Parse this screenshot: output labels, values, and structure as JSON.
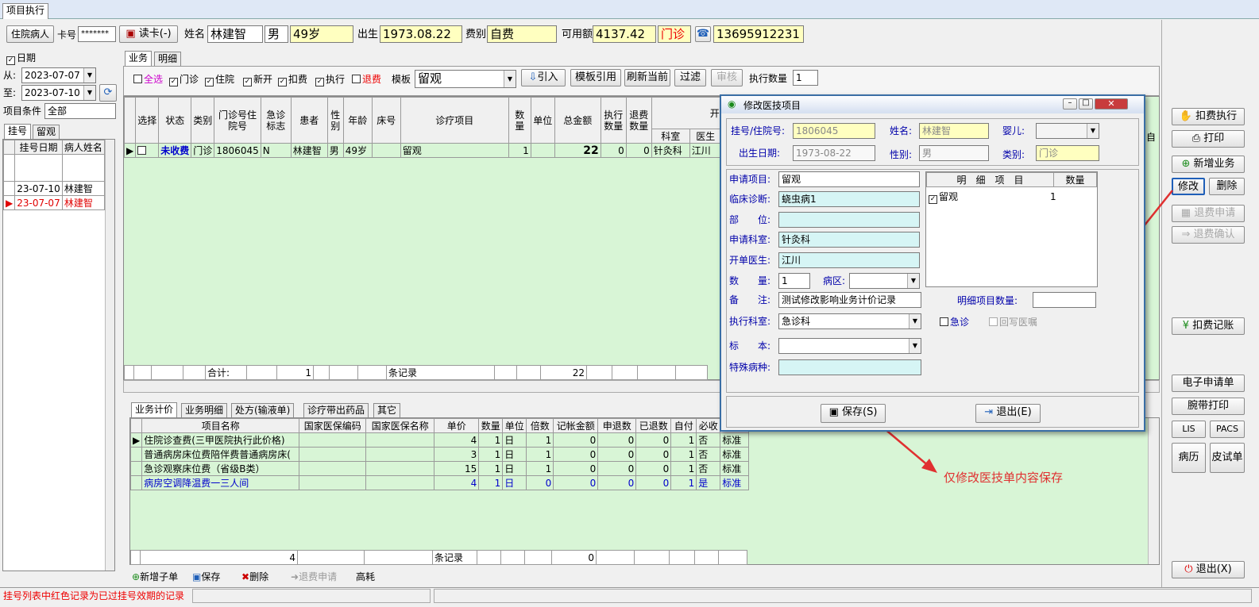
{
  "window": {
    "tab": "项目执行"
  },
  "topbar": {
    "inpatient_btn": "住院病人",
    "card_label": "卡号",
    "card_value": "*******",
    "read_card_btn": "读卡(-)",
    "name_label": "姓名",
    "name": "林建智",
    "gender": "男",
    "age": "49岁",
    "dob_label": "出生",
    "dob": "1973.08.22",
    "fee_label": "费别",
    "fee_type": "自费",
    "balance_label": "可用额",
    "balance": "4137.42",
    "visit_type": "门诊",
    "phone": "13695912231"
  },
  "left": {
    "date_label": "日期",
    "from_label": "从:",
    "from_date": "2023-07-07",
    "to_label": "至:",
    "to_date": "2023-07-10",
    "cond_label": "项目条件",
    "cond_value": "全部",
    "tabs": [
      "挂号",
      "留观"
    ],
    "cols": [
      "挂号日期",
      "病人姓名"
    ],
    "rows": [
      {
        "date": "23-07-10",
        "name": "林建智"
      },
      {
        "date": "23-07-07",
        "name": "林建智"
      }
    ]
  },
  "main_tabs": [
    "业务",
    "明细"
  ],
  "filter": {
    "all": "全选",
    "outpatient": "门诊",
    "inpatient": "住院",
    "new": "新开",
    "deduct": "扣费",
    "execute": "执行",
    "refund": "退费",
    "template_label": "模板",
    "template_value": "留观",
    "import_btn": "引入",
    "tpl_ref_btn": "模板引用",
    "refresh_btn": "刷新当前",
    "filter_btn": "过滤",
    "audit_btn": "审核",
    "exec_qty_label": "执行数量",
    "exec_qty": "1"
  },
  "grid": {
    "cols": [
      "选择",
      "状态",
      "类别",
      "门诊号住院号",
      "急诊标志",
      "患者",
      "性别",
      "年龄",
      "床号",
      "诊疗项目",
      "数量",
      "单位",
      "总金额",
      "执行数量",
      "退费数量",
      "科室",
      "医生"
    ],
    "group_header": "开",
    "row": {
      "status": "未收费",
      "type": "门诊",
      "no": "1806045",
      "urgent": "N",
      "patient": "林建智",
      "gender": "男",
      "age": "49岁",
      "bed": "",
      "item": "留观",
      "qty": "1",
      "unit": "",
      "total": "22",
      "exec": "0",
      "refund": "0",
      "dept": "针灸科",
      "doctor": "江川"
    },
    "footer": {
      "sum_label": "合计:",
      "qty": "1",
      "rec_label": "条记录",
      "total": "22"
    },
    "right_edge": "自"
  },
  "lower_tabs": [
    "业务计价",
    "业务明细",
    "处方(输液单)",
    "诊疗带出药品",
    "其它"
  ],
  "price": {
    "cols": [
      "项目名称",
      "国家医保编码",
      "国家医保名称",
      "单价",
      "数量",
      "单位",
      "倍数",
      "记帐金额",
      "申退数",
      "已退数",
      "自付",
      "必收",
      ""
    ],
    "rows": [
      {
        "name": "住院诊查费(三甲医院执行此价格)",
        "code": "",
        "cname": "",
        "price": "4",
        "qty": "1",
        "unit": "日",
        "mult": "1",
        "amt": "0",
        "req": "0",
        "ret": "0",
        "self": "1",
        "must": "否",
        "std": "标准"
      },
      {
        "name": "普通病房床位费陪伴费普通病房床(",
        "code": "",
        "cname": "",
        "price": "3",
        "qty": "1",
        "unit": "日",
        "mult": "1",
        "amt": "0",
        "req": "0",
        "ret": "0",
        "self": "1",
        "must": "否",
        "std": "标准"
      },
      {
        "name": "急诊观察床位费（省级B类）",
        "code": "",
        "cname": "",
        "price": "15",
        "qty": "1",
        "unit": "日",
        "mult": "1",
        "amt": "0",
        "req": "0",
        "ret": "0",
        "self": "1",
        "must": "否",
        "std": "标准"
      },
      {
        "name": "病房空调降温费一三人间",
        "code": "",
        "cname": "",
        "price": "4",
        "qty": "1",
        "unit": "日",
        "mult": "0",
        "amt": "0",
        "req": "0",
        "ret": "0",
        "self": "1",
        "must": "是",
        "std": "标准"
      }
    ],
    "footer": {
      "count": "4",
      "rec_label": "条记录",
      "amt": "0"
    }
  },
  "bottom_btns": {
    "add_sub": "新增子单",
    "save": "保存",
    "delete": "删除",
    "refund_req": "退费申请",
    "consumable": "高耗"
  },
  "right_btns": {
    "deduct_exec": "扣费执行",
    "print": "打印",
    "add_biz": "新增业务",
    "modify": "修改",
    "delete": "删除",
    "refund_req": "退费申请",
    "refund_confirm": "退费确认",
    "deduct_account": "扣费记账",
    "e_request": "电子申请单",
    "wrist_print": "腕带打印",
    "lis": "LIS",
    "pacs": "PACS",
    "record": "病历",
    "skin_test": "皮试单",
    "exit": "退出(X)"
  },
  "dialog": {
    "title": "修改医技项目",
    "reg_label": "挂号/住院号:",
    "reg_no": "1806045",
    "name_label": "姓名:",
    "name": "林建智",
    "baby_label": "婴儿:",
    "dob_label": "出生日期:",
    "dob": "1973-08-22",
    "gender_label": "性别:",
    "gender": "男",
    "type_label": "类别:",
    "type": "门诊",
    "apply_item_label": "申请项目:",
    "apply_item": "留观",
    "diag_label": "临床诊断:",
    "diag": "蛲虫病1",
    "part_label": "部　　位:",
    "dept_label": "申请科室:",
    "dept": "针灸科",
    "doctor_label": "开单医生:",
    "doctor": "江川",
    "qty_label": "数　　量:",
    "qty": "1",
    "ward_label": "病区:",
    "remark_label": "备　　注:",
    "remark": "测试修改影响业务计价记录",
    "detail_qty_label": "明细项目数量:",
    "exec_dept_label": "执行科室:",
    "exec_dept": "急诊科",
    "urgent_label": "急诊",
    "rewrite_label": "回写医嘱",
    "specimen_label": "标　　本:",
    "special_label": "特殊病种:",
    "detail_cols": [
      "明　细　项　目",
      "数量"
    ],
    "detail_rows": [
      {
        "item": "留观",
        "qty": "1"
      }
    ],
    "save_btn": "保存(S)",
    "exit_btn": "退出(E)"
  },
  "annotation": "仅修改医技单内容保存",
  "status": {
    "message": "挂号列表中红色记录为已过挂号效期的记录"
  },
  "colors": {
    "grid_bg": "#d8f5d6",
    "accent_red": "#e03030",
    "title_blue": "#1f5fb8"
  }
}
